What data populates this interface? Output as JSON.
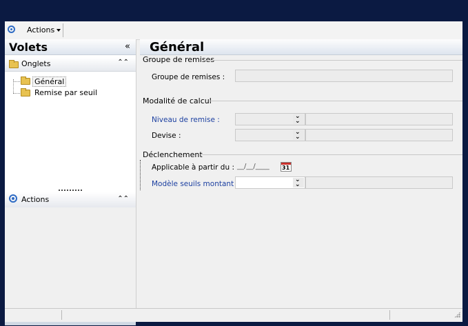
{
  "toolbar": {
    "actions_label": "Actions"
  },
  "left": {
    "title": "Volets",
    "collapse_glyph": "«",
    "onglets_label": "Onglets",
    "tree": [
      "Général",
      "Remise par seuil"
    ],
    "actions_label": "Actions"
  },
  "main": {
    "title": "Général",
    "groups": {
      "remises": {
        "title": "Groupe de remises",
        "field_label": "Groupe de remises :"
      },
      "calcul": {
        "title": "Modalité de calcul",
        "niveau_label": "Niveau de remise :",
        "devise_label": "Devise :"
      },
      "declenchement": {
        "title": "Déclenchement",
        "applicable_label": "Applicable à partir du :",
        "date_placeholder": "__/__/____",
        "calendar_day": "31",
        "modele_label": "Modèle seuils montant :"
      }
    }
  },
  "colors": {
    "accent": "#2e6bc4",
    "link_label": "#1b3fa0",
    "background": "#0b1a42"
  }
}
